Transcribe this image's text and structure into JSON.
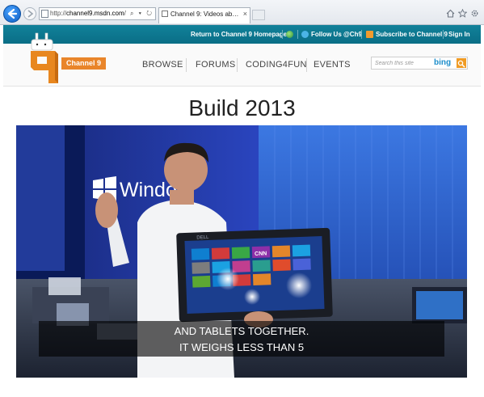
{
  "browser": {
    "address_scheme": "http://",
    "address_domain": "channel9.msdn.com",
    "address_path": "/",
    "address_tools": "⌕ ▾ ↻",
    "tab_title": "Channel 9: Videos about th...",
    "tab_close": "×"
  },
  "topbar": {
    "homepage_link": "Return to Channel 9 Homepage",
    "follow_link": "Follow Us @Ch9",
    "subscribe_link": "Subscribe to Channel 9",
    "signin_link": "Sign In",
    "separator": "|"
  },
  "header": {
    "brand_name": "Channel 9",
    "nav": [
      "BROWSE",
      "FORUMS",
      "CODING4FUN",
      "EVENTS"
    ],
    "search_placeholder": "Search this site",
    "search_brand": "bing"
  },
  "page": {
    "title": "Build 2013"
  },
  "video": {
    "caption_line1": "AND TABLETS TOGETHER.",
    "caption_line2": "IT WEIGHS LESS THAN 5",
    "backdrop_text": "Windo",
    "tablet_brand": "DELL",
    "tile_text": "CNN"
  },
  "colors": {
    "teal_bar": "#0a6e86",
    "brand_orange": "#e9852a",
    "bing_blue": "#1d8ecb"
  }
}
